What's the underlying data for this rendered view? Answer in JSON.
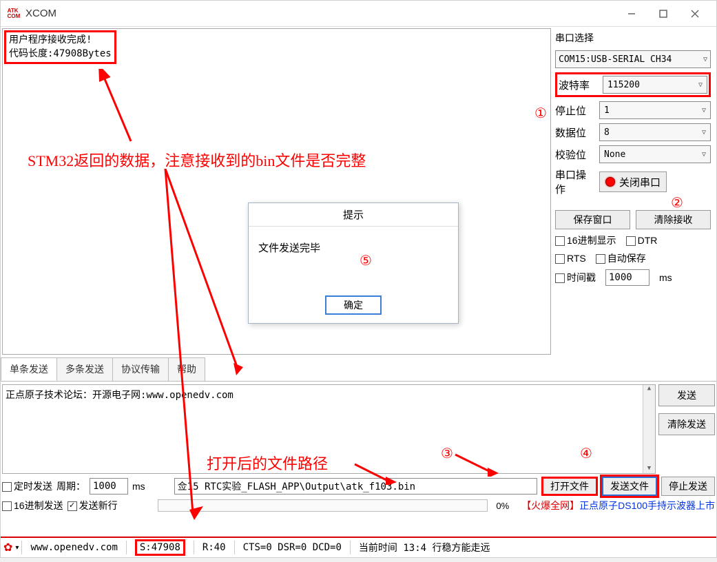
{
  "title": "XCOM",
  "output": {
    "line1": "用户程序接收完成!",
    "line2": "代码长度:47908Bytes"
  },
  "sidepanel": {
    "serial_section": "串口选择",
    "port": "COM15:USB-SERIAL CH34",
    "baud_label": "波特率",
    "baud": "115200",
    "stop_label": "停止位",
    "stop": "1",
    "data_label": "数据位",
    "data": "8",
    "parity_label": "校验位",
    "parity": "None",
    "op_label": "串口操作",
    "op_btn": "关闭串口",
    "save_btn": "保存窗口",
    "clear_btn": "清除接收",
    "hex_disp": "16进制显示",
    "dtr": "DTR",
    "rts": "RTS",
    "autosave": "自动保存",
    "timestamp": "时间戳",
    "ts_val": "1000",
    "ts_unit": "ms"
  },
  "tabs": {
    "t1": "单条发送",
    "t2": "多条发送",
    "t3": "协议传输",
    "t4": "帮助"
  },
  "send": {
    "text": "正点原子技术论坛：开源电子网:www.openedv.com",
    "send_btn": "发送",
    "clear_btn": "清除发送"
  },
  "ctl": {
    "sched": "定时发送",
    "period_lbl": "周期：",
    "period": "1000",
    "period_unit": "ms",
    "hex_send": "16进制发送",
    "newline": "发送新行",
    "path": "佥15 RTC实验_FLASH_APP\\Output\\atk_f103.bin",
    "open_btn": "打开文件",
    "sendfile_btn": "发送文件",
    "stop_btn": "停止发送",
    "pct": "0%",
    "promo_red": "【火爆全网】",
    "promo": "正点原子DS100手持示波器上市"
  },
  "status": {
    "url": "www.openedv.com",
    "s": "S:47908",
    "r": "R:40",
    "lines": "CTS=0 DSR=0 DCD=0",
    "time": "当前时间 13:4 行稳方能走远"
  },
  "dialog": {
    "title": "提示",
    "msg": "文件发送完毕",
    "ok": "确定"
  },
  "anno": {
    "main": "STM32返回的数据，注意接收到的bin文件是否完整",
    "path": "打开后的文件路径",
    "n1": "①",
    "n2": "②",
    "n3": "③",
    "n4": "④",
    "n5": "⑤"
  },
  "watermark": ""
}
